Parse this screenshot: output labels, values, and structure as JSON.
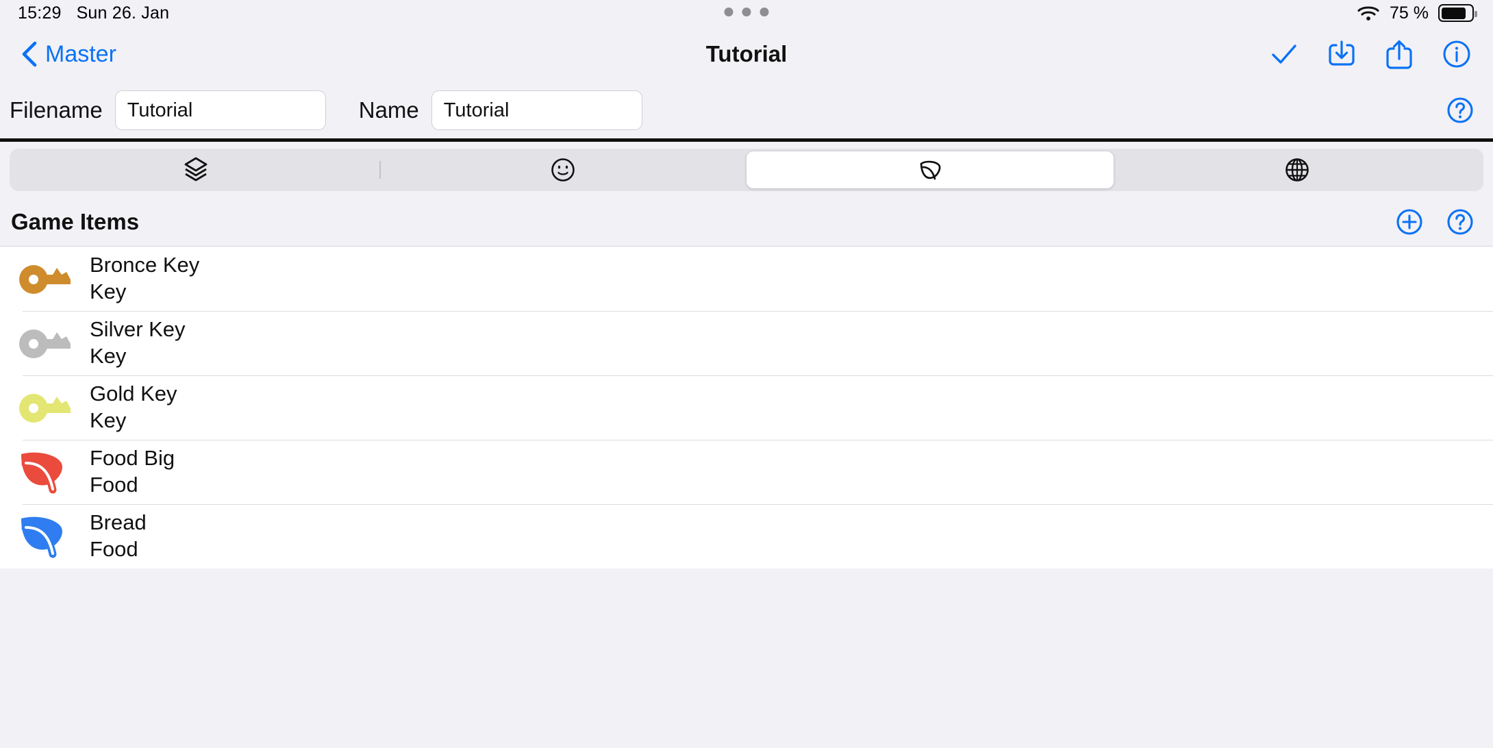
{
  "status_bar": {
    "time": "15:29",
    "date": "Sun 26. Jan",
    "battery_percent": "75 %",
    "wifi_icon": "wifi-icon",
    "battery_icon": "battery-icon",
    "dots_icon": "more-dots-indicator"
  },
  "nav": {
    "back_label": "Master",
    "back_icon": "chevron-left-icon",
    "title": "Tutorial",
    "actions": [
      {
        "name": "confirm-button",
        "icon": "checkmark-icon"
      },
      {
        "name": "import-button",
        "icon": "download-square-icon"
      },
      {
        "name": "share-button",
        "icon": "share-square-icon"
      },
      {
        "name": "info-button",
        "icon": "info-circle-icon"
      }
    ]
  },
  "form": {
    "filename_label": "Filename",
    "filename_value": "Tutorial",
    "filename_placeholder": "Filename",
    "name_label": "Name",
    "name_value": "Tutorial",
    "name_placeholder": "Name",
    "help_icon": "question-circle-icon"
  },
  "tabs": [
    {
      "name": "tab-layers",
      "icon": "layers-icon",
      "selected": false
    },
    {
      "name": "tab-characters",
      "icon": "smiley-face-icon",
      "selected": false
    },
    {
      "name": "tab-items",
      "icon": "leaf-icon",
      "selected": true
    },
    {
      "name": "tab-world",
      "icon": "globe-icon",
      "selected": false
    }
  ],
  "section": {
    "title": "Game Items",
    "add_icon": "plus-circle-icon",
    "help_icon": "question-circle-icon"
  },
  "items": [
    {
      "title": "Bronce Key",
      "subtitle": "Key",
      "icon": "key-icon",
      "color": "#cf8c2c"
    },
    {
      "title": "Silver Key",
      "subtitle": "Key",
      "icon": "key-icon",
      "color": "#bcbcbc"
    },
    {
      "title": "Gold Key",
      "subtitle": "Key",
      "icon": "key-icon",
      "color": "#e3e672"
    },
    {
      "title": "Food Big",
      "subtitle": "Food",
      "icon": "leaf-icon",
      "color": "#ea4b3c"
    },
    {
      "title": "Bread",
      "subtitle": "Food",
      "icon": "leaf-icon",
      "color": "#2f7df0"
    }
  ],
  "colors": {
    "accent": "#0a72f5",
    "background": "#f2f1f6",
    "list_background": "#ffffff",
    "segment_track": "#e3e2e7"
  }
}
